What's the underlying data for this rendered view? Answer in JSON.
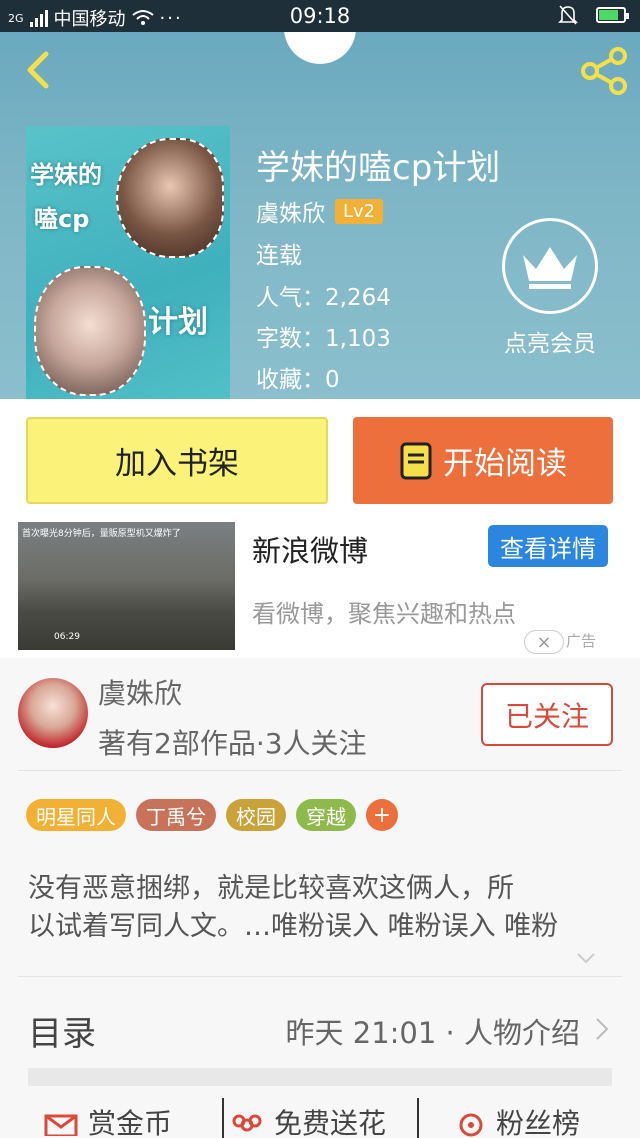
{
  "status_bar": {
    "network": "2G",
    "carrier": "中国移动",
    "time": "09:18",
    "battery_level": 0.8
  },
  "book": {
    "title": "学妹的嗑cp计划",
    "author": "虞姝欣",
    "level": "Lv2",
    "status": "连载",
    "popularity": "人气：2,264",
    "word_count": "字数：1,103",
    "favorites": "收藏：0",
    "cover_title_lines": [
      "学妹的",
      "嗑cp",
      "计划"
    ]
  },
  "vip": {
    "label": "点亮会员"
  },
  "actions": {
    "add_shelf": "加入书架",
    "start_read": "开始阅读"
  },
  "ad": {
    "thumb_caption": "首次曝光8分钟后，量販原型机又爆炸了",
    "thumb_duration": "06:29",
    "name": "新浪微博",
    "cta": "查看详情",
    "description": "看微博，聚焦兴趣和热点",
    "tag": "广告",
    "close": "×"
  },
  "author_card": {
    "name": "虞姝欣",
    "stats": "著有2部作品·3人关注",
    "follow_state": "已关注"
  },
  "tags": [
    {
      "label": "明星同人",
      "color": "#f2b134"
    },
    {
      "label": "丁禹兮",
      "color": "#c7735a"
    },
    {
      "label": "校园",
      "color": "#c9a23a"
    },
    {
      "label": "穿越",
      "color": "#8dba4a"
    }
  ],
  "tag_more": {
    "label": "+",
    "color": "#ec6f3c"
  },
  "intro": {
    "line1": "没有恶意捆绑，就是比较喜欢这俩人，所",
    "line2": "以试着写同人文。…唯粉误入 唯粉误入 唯粉"
  },
  "toc": {
    "label": "目录",
    "update": "昨天 21:01 · 人物介绍"
  },
  "bottom_bar": {
    "reward": "赏金币",
    "flowers": "免费送花",
    "fans": "粉丝榜"
  },
  "colors": {
    "accent_orange": "#ec6f3c",
    "shelf_yellow": "#fbf27a",
    "follow_red": "#d84b3a",
    "ad_blue": "#2b86e0"
  }
}
